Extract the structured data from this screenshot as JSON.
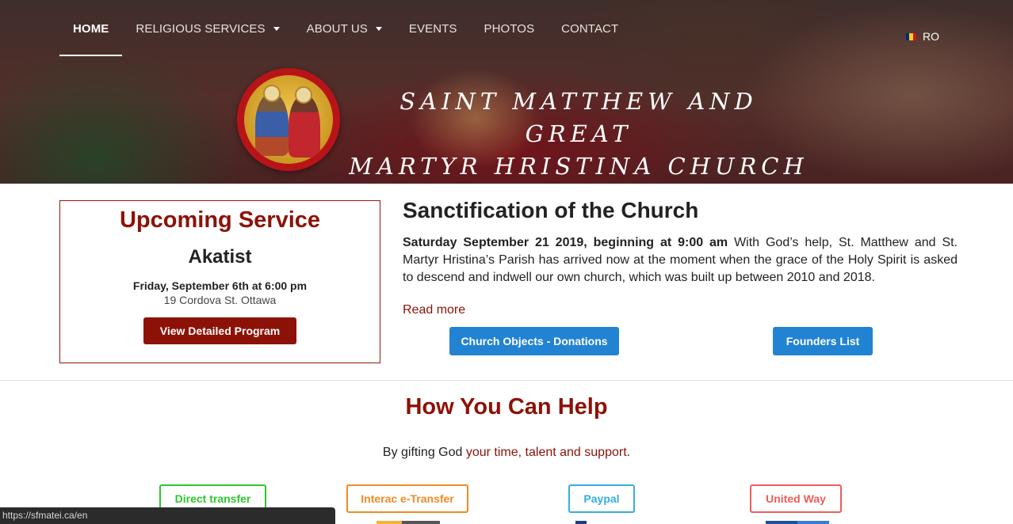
{
  "nav": {
    "items": [
      {
        "label": "HOME",
        "active": true,
        "dropdown": false
      },
      {
        "label": "RELIGIOUS SERVICES",
        "active": false,
        "dropdown": true
      },
      {
        "label": "ABOUT US",
        "active": false,
        "dropdown": true
      },
      {
        "label": "EVENTS",
        "active": false,
        "dropdown": false
      },
      {
        "label": "PHOTOS",
        "active": false,
        "dropdown": false
      },
      {
        "label": "CONTACT",
        "active": false,
        "dropdown": false
      }
    ],
    "language": "RO",
    "flag_colors": [
      "#002b7f",
      "#fcd116",
      "#ce1126"
    ]
  },
  "hero": {
    "title_line1": "Saint Matthew and Great",
    "title_line2": "Martyr Hristina Church"
  },
  "service": {
    "heading": "Upcoming Service",
    "name": "Akatist",
    "date": "Friday, September 6th at 6:00 pm",
    "address": "19 Cordova St. Ottawa",
    "button": "View Detailed Program"
  },
  "article": {
    "title": "Sanctification of the Church",
    "lead": "Saturday September 21 2019, beginning at 9:00 am",
    "body": " With God’s help, St. Matthew and St. Martyr Hristina’s Parish has arrived now at the moment when the grace of the Holy Spirit is asked to descend and indwell our own church, which was built up between 2010 and 2018.",
    "read_more": "Read more",
    "donations_button": "Church Objects - Donations",
    "founders_button": "Founders List"
  },
  "help": {
    "title": "How You Can Help",
    "subtitle_prefix": "By gifting God ",
    "subtitle_highlight": "your time, talent and support",
    "subtitle_suffix": ".",
    "options": [
      {
        "label": "Direct transfer",
        "color": "#2fc52f"
      },
      {
        "label": "Interac e-Transfer",
        "color": "#f08a24"
      },
      {
        "label": "Paypal",
        "color": "#35aee2"
      },
      {
        "label": "United Way",
        "color": "#ee5c5c"
      }
    ]
  },
  "colors": {
    "accent": "#8c1208",
    "blue": "#2383d3"
  },
  "status_bar": {
    "url": "https://sfmatei.ca/en"
  }
}
